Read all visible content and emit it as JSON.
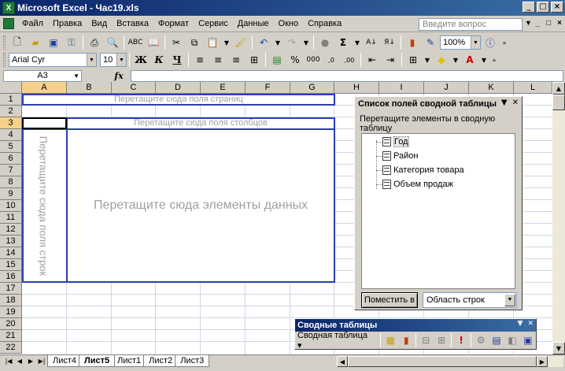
{
  "window": {
    "title": "Microsoft Excel - Час19.xls",
    "app_icon": "X",
    "controls": [
      "_",
      "□",
      "×"
    ]
  },
  "menu": {
    "items": [
      "Файл",
      "Правка",
      "Вид",
      "Вставка",
      "Формат",
      "Сервис",
      "Данные",
      "Окно",
      "Справка"
    ],
    "help_placeholder": "Введите вопрос",
    "doc_controls": [
      "_",
      "□",
      "×"
    ]
  },
  "toolbar": {
    "zoom": "100%",
    "font_name": "Arial Cyr",
    "font_size": "10",
    "bold": "Ж",
    "italic": "К",
    "underline": "Ч",
    "percent": "%",
    "thousands": "000"
  },
  "formula_bar": {
    "name_box": "A3",
    "fx": "fx",
    "value": ""
  },
  "grid": {
    "columns": [
      "A",
      "B",
      "C",
      "D",
      "E",
      "F",
      "G",
      "H",
      "I",
      "J",
      "K",
      "L"
    ],
    "rows": [
      "1",
      "2",
      "3",
      "4",
      "5",
      "6",
      "7",
      "8",
      "9",
      "10",
      "11",
      "12",
      "13",
      "14",
      "15",
      "16",
      "17",
      "18",
      "19",
      "20",
      "21",
      "22"
    ],
    "selected_column": "A",
    "selected_row": "3"
  },
  "pivot": {
    "page_drop": "Перетащите сюда поля страниц",
    "column_drop": "Перетащите сюда поля столбцов",
    "row_drop": "Перетащите сюда поля строк",
    "data_drop": "Перетащите сюда элементы данных"
  },
  "field_panel": {
    "title": "Список полей сводной таблицы",
    "description": "Перетащите элементы в сводную таблицу",
    "fields": [
      "Год",
      "Район",
      "Категория товара",
      "Объем продаж"
    ],
    "selected_field": "Год",
    "place_button": "Поместить в",
    "area_value": "Область строк"
  },
  "pivot_toolbar": {
    "title": "Сводные таблицы",
    "menu_label": "Сводная таблица ▾"
  },
  "sheets": {
    "tabs": [
      "Лист4",
      "Лист5",
      "Лист1",
      "Лист2",
      "Лист3"
    ],
    "active": "Лист5"
  }
}
